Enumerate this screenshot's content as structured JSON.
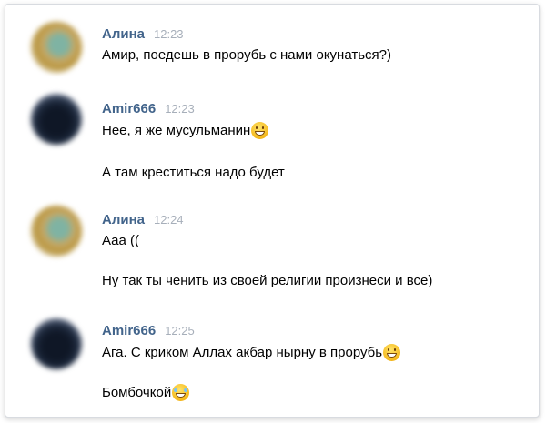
{
  "messages": [
    {
      "author": "Алина",
      "time": "12:23",
      "lines": [
        {
          "text": "Амир, поедешь в прорубь с нами окунаться?)",
          "emoji": ""
        }
      ]
    },
    {
      "author": "Amir666",
      "time": "12:23",
      "lines": [
        {
          "text": "Нее, я же мусульманин",
          "emoji": "grinning-face-emoji"
        },
        {
          "text": "А там креститься надо будет",
          "emoji": ""
        }
      ]
    },
    {
      "author": "Алина",
      "time": "12:24",
      "lines": [
        {
          "text": "Ааа ((",
          "emoji": ""
        },
        {
          "text": "Ну так ты ченить из своей религии произнеси и все)",
          "emoji": ""
        }
      ]
    },
    {
      "author": "Amir666",
      "time": "12:25",
      "lines": [
        {
          "text": "Ага. С криком Аллах акбар нырну в прорубь",
          "emoji": "grinning-face-emoji"
        },
        {
          "text": "Бомбочкой",
          "emoji": "tears-of-joy-emoji"
        }
      ]
    }
  ],
  "colors": {
    "author_name": "#42648b",
    "timestamp": "#a7afba",
    "text": "#000000"
  }
}
